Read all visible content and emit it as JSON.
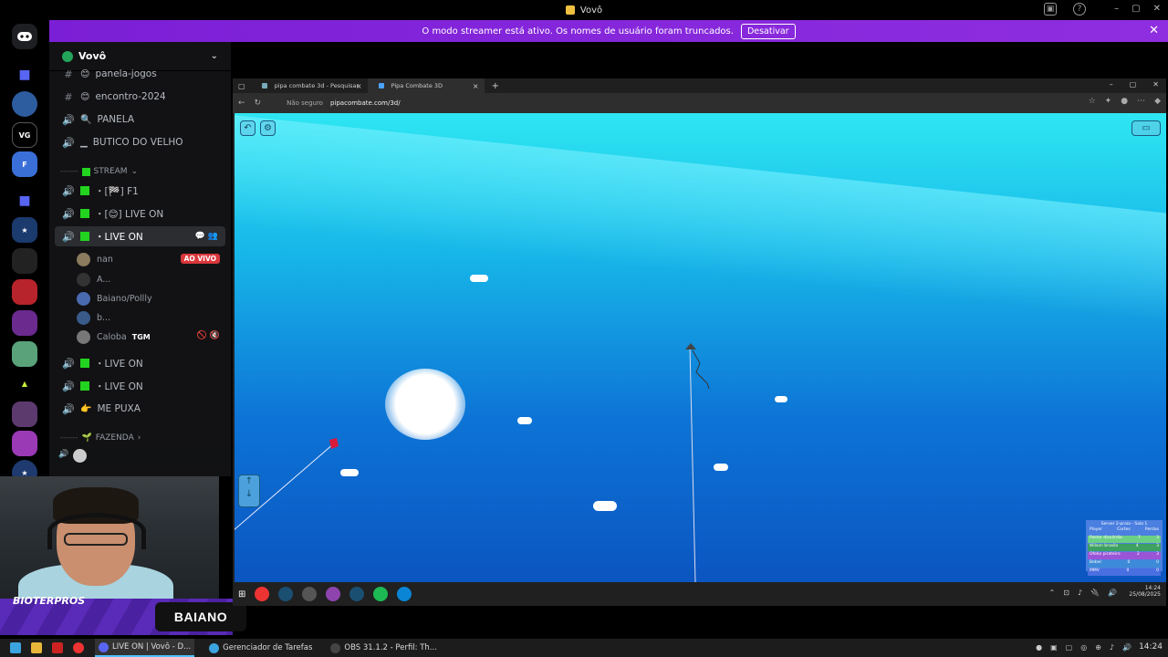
{
  "window": {
    "title": "Vovô"
  },
  "banner": {
    "text": "O modo streamer está ativo. Os nomes de usuário foram truncados.",
    "button": "Desativar",
    "close": "✕"
  },
  "server": {
    "name": "Vovô"
  },
  "channels": [
    {
      "icon": "#",
      "emoji": "😊",
      "label": "panela-jogos"
    },
    {
      "icon": "#",
      "emoji": "😊",
      "label": "encontro-2024"
    },
    {
      "icon": "🔊",
      "emoji": "🔍",
      "label": "PANELA"
    },
    {
      "icon": "🔊",
      "emoji": "▁",
      "label": "BUTICO DO VELHO"
    }
  ],
  "category_stream": "STREAM",
  "stream_channels": [
    {
      "label": "・[🏁] F1"
    },
    {
      "label": "・[😊] LIVE ON"
    },
    {
      "label": "・LIVE ON"
    }
  ],
  "voice_users": [
    {
      "name": "nan",
      "badge": "AO VIVO"
    },
    {
      "name": "A..."
    },
    {
      "name": "Baiano/Pollly"
    },
    {
      "name": "b..."
    },
    {
      "name": "Caloba",
      "tag": "TGM"
    }
  ],
  "more_channels": [
    {
      "label": "・LIVE ON"
    },
    {
      "label": "・LIVE ON"
    },
    {
      "label": "ME PUXA",
      "emoji": "👉"
    }
  ],
  "category_fazenda": "FAZENDA",
  "overlay": {
    "top_text": "BIOTERPROS",
    "name_tag": "BAIANO"
  },
  "browser": {
    "tabs": [
      {
        "label": "pipa combate 3d - Pesquisar",
        "close": "×"
      },
      {
        "label": "Pipa Combate 3D",
        "close": "×"
      }
    ],
    "new_tab": "+",
    "not_secure": "Não seguro",
    "url": "pipacombate.com/3d/",
    "window_controls": [
      "–",
      "▢",
      "✕"
    ]
  },
  "game": {
    "scoreboard": {
      "title": "Server 2-praia - Sala 1",
      "headers": [
        "Player",
        "Cortes",
        "Perdas"
      ],
      "rows": [
        {
          "name": "Pastor discórdia",
          "cortes": "7",
          "perdas": "3",
          "color": "#6ccf86"
        },
        {
          "name": "Wilson brasilo",
          "cortes": "4",
          "perdas": "3",
          "color": "#3ea061"
        },
        {
          "name": "Ofelio pirateiro",
          "cortes": "2",
          "perdas": "3",
          "color": "#9a55d6"
        },
        {
          "name": "Bebel",
          "cortes": "0",
          "perdas": "0",
          "color": "#3d8ad8"
        },
        {
          "name": "MMV",
          "cortes": "0",
          "perdas": "0",
          "color": "#4a6fe0"
        }
      ]
    }
  },
  "vm_clock": {
    "time": "14:24",
    "date": "25/08/2025"
  },
  "taskbar": {
    "apps": [
      {
        "label": "LIVE ON | Vovô - D...",
        "color": "#5865f2",
        "selected": true
      },
      {
        "label": "Gerenciador de Tarefas",
        "color": "#3ba3e0",
        "selected": false
      },
      {
        "label": "OBS 31.1.2 - Perfil: Th...",
        "color": "#444",
        "selected": false
      }
    ],
    "clock": "14:24"
  }
}
